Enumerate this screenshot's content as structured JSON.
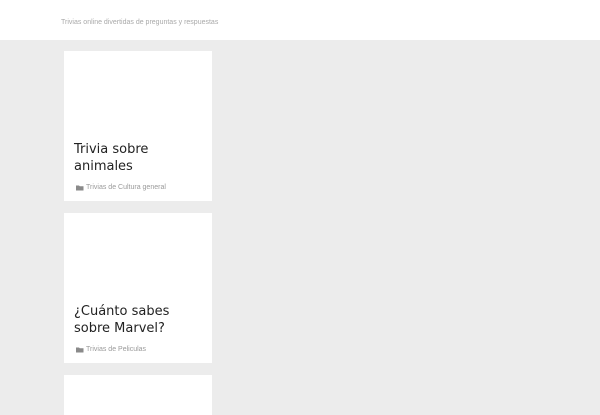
{
  "header": {
    "tagline": "Trivias online divertidas de preguntas y respuestas"
  },
  "posts": [
    {
      "title": "Trivia sobre animales",
      "category": "Trivias de Cultura general",
      "category_icon": "folder-icon"
    },
    {
      "title": "¿Cuánto sabes sobre Marvel?",
      "category": "Trivias de Peliculas",
      "category_icon": "folder-icon"
    },
    {
      "title": "",
      "category": ""
    }
  ],
  "colors": {
    "page_background": "#ececec",
    "card_background": "#ffffff",
    "title_text": "#222222",
    "meta_text": "#9a9a9a"
  }
}
